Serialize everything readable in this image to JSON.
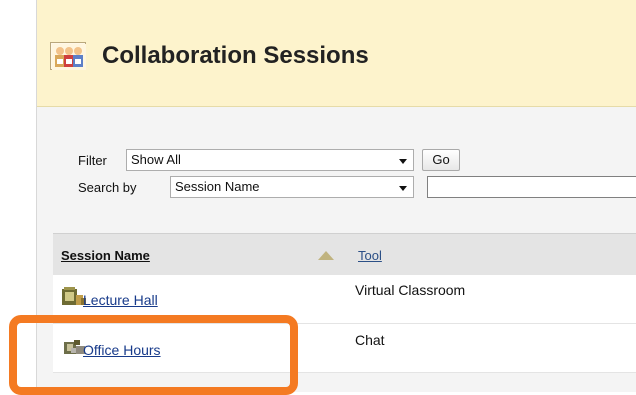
{
  "header": {
    "title": "Collaboration Sessions",
    "icon": "collaboration-icon"
  },
  "filter": {
    "filter_label": "Filter",
    "filter_value": "Show All",
    "go_label": "Go",
    "search_label": "Search by",
    "search_by_value": "Session Name",
    "search_text": ""
  },
  "table": {
    "headers": [
      "Session Name",
      "Tool"
    ],
    "sort_indicator": "ascending",
    "rows": [
      {
        "session": "Lecture Hall",
        "tool": "Virtual Classroom",
        "icon": "classroom-icon"
      },
      {
        "session": "Office Hours",
        "tool": "Chat",
        "icon": "chat-icon"
      }
    ]
  },
  "colors": {
    "header_bg": "#fdf3cc",
    "highlight": "#f47a22",
    "link": "#173a8a"
  }
}
